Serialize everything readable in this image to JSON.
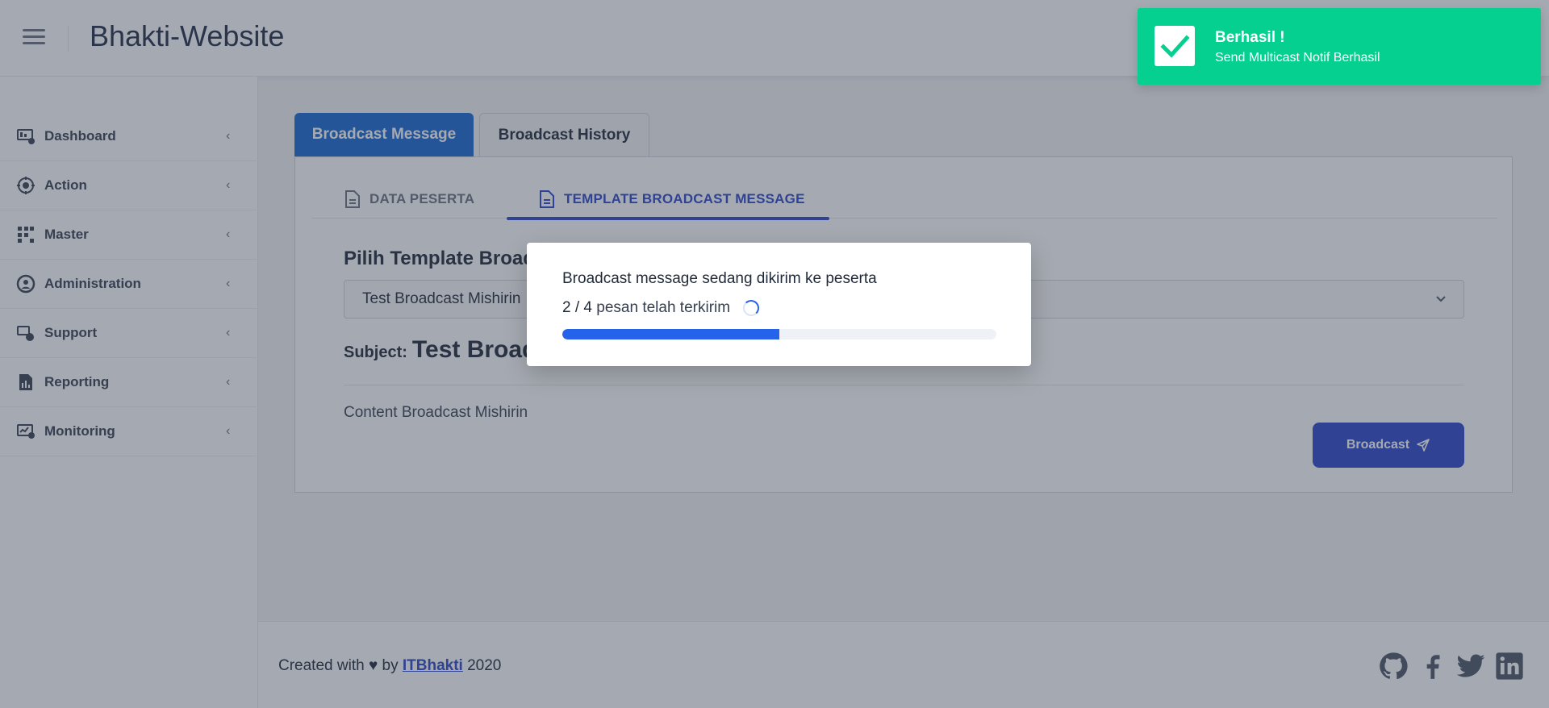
{
  "header": {
    "title": "Bhakti-Website"
  },
  "sidebar": {
    "items": [
      {
        "label": "Dashboard",
        "icon": "dashboard-icon"
      },
      {
        "label": "Action",
        "icon": "action-icon"
      },
      {
        "label": "Master",
        "icon": "master-icon"
      },
      {
        "label": "Administration",
        "icon": "administration-icon"
      },
      {
        "label": "Support",
        "icon": "support-icon"
      },
      {
        "label": "Reporting",
        "icon": "reporting-icon"
      },
      {
        "label": "Monitoring",
        "icon": "monitoring-icon"
      }
    ]
  },
  "main": {
    "tabs": [
      {
        "label": "Broadcast Message",
        "active": true
      },
      {
        "label": "Broadcast History",
        "active": false
      }
    ],
    "subtabs": [
      {
        "label": "DATA PESERTA",
        "active": false
      },
      {
        "label": "TEMPLATE BROADCAST MESSAGE",
        "active": true
      }
    ],
    "template_label": "Pilih Template Broad",
    "template_selected": "Test Broadcast Mishirin",
    "subject_label": "Subject:",
    "subject_value": "Test Broad",
    "content": "Content Broadcast Mishirin",
    "broadcast_button": "Broadcast"
  },
  "modal": {
    "title": "Broadcast message sedang dikirim ke peserta",
    "sent": "2",
    "separator": "/",
    "total": "4",
    "progress_text": "pesan telah terkirim",
    "progress_fraction": 0.5
  },
  "toast": {
    "title": "Berhasil !",
    "message": "Send Multicast Notif Berhasil",
    "color": "#05d08f"
  },
  "footer": {
    "prefix": "Created with ♥ by",
    "link": "ITBhakti",
    "year": "2020",
    "socials": [
      "github-icon",
      "facebook-icon",
      "twitter-icon",
      "linkedin-icon"
    ]
  },
  "colors": {
    "primary": "#2a44c9",
    "tab_active": "#1467d4",
    "progress": "#2563eb"
  }
}
